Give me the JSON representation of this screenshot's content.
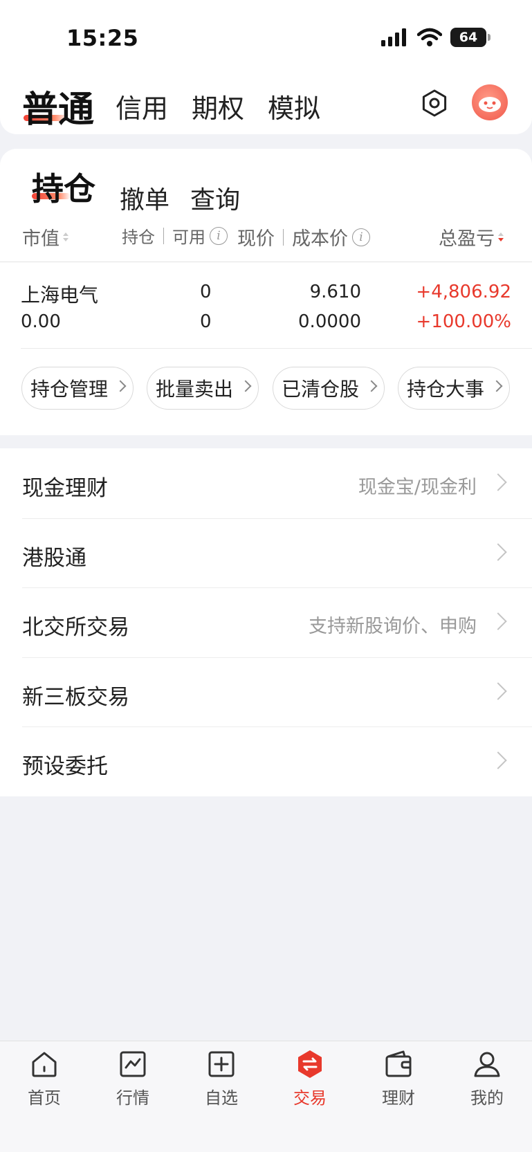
{
  "status_bar": {
    "time": "15:25",
    "battery": "64"
  },
  "header": {
    "tabs": [
      {
        "label": "普通",
        "active": true
      },
      {
        "label": "信用"
      },
      {
        "label": "期权"
      },
      {
        "label": "模拟"
      }
    ],
    "settings_icon": "settings-hexagon-icon",
    "avatar_icon": "mascot-avatar"
  },
  "positions": {
    "tabs": [
      {
        "label": "持仓",
        "active": true
      },
      {
        "label": "撤单"
      },
      {
        "label": "查询"
      }
    ],
    "columns": {
      "market_value": "市值",
      "holding": "持仓",
      "available": "可用",
      "price": "现价",
      "cost": "成本价",
      "pnl": "总盈亏"
    },
    "rows": [
      {
        "name": "上海电气",
        "market_value": "0.00",
        "holding": "0",
        "available": "0",
        "price": "9.610",
        "cost": "0.0000",
        "pnl": "+4,806.92",
        "pnl_pct": "+100.00%"
      }
    ],
    "actions": [
      "持仓管理",
      "批量卖出",
      "已清仓股",
      "持仓大事"
    ]
  },
  "menu": [
    {
      "label": "现金理财",
      "hint": "现金宝/现金利"
    },
    {
      "label": "港股通",
      "hint": ""
    },
    {
      "label": "北交所交易",
      "hint": "支持新股询价、申购"
    },
    {
      "label": "新三板交易",
      "hint": ""
    },
    {
      "label": "预设委托",
      "hint": ""
    }
  ],
  "bottom_nav": [
    {
      "label": "首页",
      "icon": "home-icon"
    },
    {
      "label": "行情",
      "icon": "market-chart-icon"
    },
    {
      "label": "自选",
      "icon": "add-favorite-icon"
    },
    {
      "label": "交易",
      "icon": "trade-exchange-icon",
      "active": true
    },
    {
      "label": "理财",
      "icon": "wallet-icon"
    },
    {
      "label": "我的",
      "icon": "profile-icon"
    }
  ],
  "colors": {
    "accent": "#e8392c",
    "background": "#f1f2f6"
  }
}
